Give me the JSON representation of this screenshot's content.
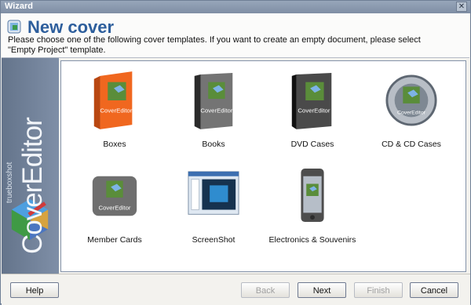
{
  "window": {
    "title": "Wizard"
  },
  "header": {
    "title": "New cover",
    "description": "Please choose one of the following cover templates. If you want to create an empty document, please select \"Empty Project\" template."
  },
  "sidebar": {
    "brand": "CoverEditor",
    "brand_small": "trueboxshot"
  },
  "templates": [
    {
      "label": "Boxes",
      "icon": "box-icon"
    },
    {
      "label": "Books",
      "icon": "book-icon"
    },
    {
      "label": "DVD Cases",
      "icon": "dvd-case-icon"
    },
    {
      "label": "CD & CD Cases",
      "icon": "cd-icon"
    },
    {
      "label": "Member Cards",
      "icon": "member-card-icon"
    },
    {
      "label": "ScreenShot",
      "icon": "screenshot-icon"
    },
    {
      "label": "Electronics & Souvenirs",
      "icon": "phone-icon"
    }
  ],
  "icon_caption": "CoverEditor",
  "buttons": {
    "help": "Help",
    "back": "Back",
    "next": "Next",
    "finish": "Finish",
    "cancel": "Cancel"
  },
  "colors": {
    "title": "#2d5e9c",
    "box": "#ef6b21",
    "sidebar": "#7f8fa7"
  }
}
